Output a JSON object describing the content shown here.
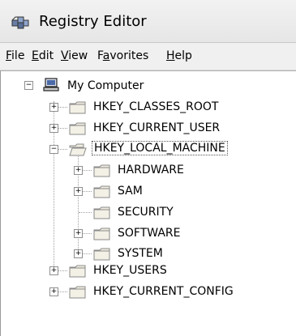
{
  "window": {
    "title": "Registry Editor"
  },
  "menu": [
    {
      "label": "File",
      "accel": "F"
    },
    {
      "label": "Edit",
      "accel": "E"
    },
    {
      "label": "View",
      "accel": "V"
    },
    {
      "label": "Favorites",
      "accel": "a"
    },
    {
      "label": "Help",
      "accel": "H"
    }
  ],
  "tree": {
    "root": {
      "label": "My Computer",
      "expanded": true
    },
    "hives": [
      {
        "label": "HKEY_CLASSES_ROOT"
      },
      {
        "label": "HKEY_CURRENT_USER"
      },
      {
        "label": "HKEY_LOCAL_MACHINE",
        "selected": true,
        "expanded": true,
        "children": [
          {
            "label": "HARDWARE"
          },
          {
            "label": "SAM"
          },
          {
            "label": "SECURITY"
          },
          {
            "label": "SOFTWARE"
          },
          {
            "label": "SYSTEM"
          }
        ]
      },
      {
        "label": "HKEY_USERS"
      },
      {
        "label": "HKEY_CURRENT_CONFIG"
      }
    ]
  },
  "icons": {
    "app": "registry-editor-icon",
    "computer": "computer-icon",
    "folder": "folder-icon",
    "folder_open": "open-folder-icon",
    "expand": "plus-icon",
    "collapse": "minus-icon"
  },
  "colors": {
    "folder": "#f0ecdf",
    "folder_border": "#8a8a8a"
  }
}
